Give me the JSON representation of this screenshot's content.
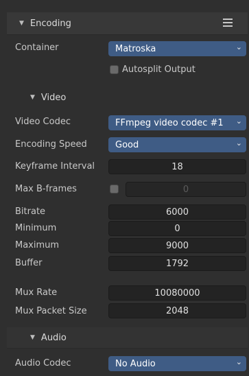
{
  "encoding": {
    "title": "Encoding",
    "container_label": "Container",
    "container_value": "Matroska",
    "autosplit_label": "Autosplit Output"
  },
  "video": {
    "title": "Video",
    "codec_label": "Video Codec",
    "codec_value": "FFmpeg video codec #1",
    "speed_label": "Encoding Speed",
    "speed_value": "Good",
    "keyframe_label": "Keyframe Interval",
    "keyframe_value": "18",
    "bframes_label": "Max B-frames",
    "bframes_value": "0",
    "bitrate_label": "Bitrate",
    "bitrate_value": "6000",
    "minimum_label": "Minimum",
    "minimum_value": "0",
    "maximum_label": "Maximum",
    "maximum_value": "9000",
    "buffer_label": "Buffer",
    "buffer_value": "1792",
    "muxrate_label": "Mux Rate",
    "muxrate_value": "10080000",
    "muxpacket_label": "Mux Packet Size",
    "muxpacket_value": "2048"
  },
  "audio": {
    "title": "Audio",
    "codec_label": "Audio Codec",
    "codec_value": "No Audio"
  },
  "icons": {
    "triangle": "▼",
    "chevron": "⌄"
  }
}
